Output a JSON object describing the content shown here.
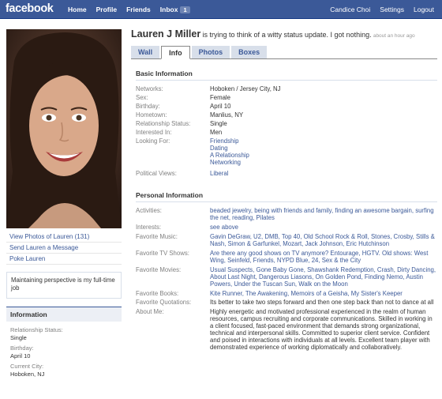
{
  "topbar": {
    "logo": "facebook",
    "nav": [
      "Home",
      "Profile",
      "Friends",
      "Inbox"
    ],
    "inbox_count": "1",
    "user": "Candice Choi",
    "settings": "Settings",
    "logout": "Logout",
    "color": "#3b5998"
  },
  "left": {
    "actions": [
      "View Photos of Lauren (131)",
      "Send Lauren a Message",
      "Poke Lauren"
    ],
    "status": "Maintaining perspective is my full-time job",
    "info_title": "Information",
    "info": [
      {
        "label": "Relationship Status:",
        "value": "Single"
      },
      {
        "label": "Birthday:",
        "value": "April 10"
      },
      {
        "label": "Current City:",
        "value": "Hoboken, NJ"
      }
    ]
  },
  "header": {
    "name": "Lauren J Miller",
    "status": "is trying to think of a witty status update. I got nothing.",
    "time": "about an hour ago"
  },
  "tabs": [
    "Wall",
    "Info",
    "Photos",
    "Boxes"
  ],
  "basic": {
    "title": "Basic Information",
    "rows": [
      {
        "label": "Networks:",
        "value": "Hoboken / Jersey City, NJ"
      },
      {
        "label": "Sex:",
        "value": "Female"
      },
      {
        "label": "Birthday:",
        "value": "April 10"
      },
      {
        "label": "Hometown:",
        "value": "Manlius, NY"
      },
      {
        "label": "Relationship Status:",
        "value": "Single"
      },
      {
        "label": "Interested In:",
        "value": "Men"
      }
    ],
    "looking_label": "Looking For:",
    "looking": [
      "Friendship",
      "Dating",
      "A Relationship",
      "Networking"
    ],
    "political_label": "Political Views:",
    "political": "Liberal"
  },
  "personal": {
    "title": "Personal Information",
    "activities_label": "Activities:",
    "activities": "beaded jewelry, being with friends and family, finding an awesome bargain, surfing the net, reading, Pilates",
    "interests_label": "Interests:",
    "interests": "see above",
    "music_label": "Favorite Music:",
    "music": "Gavin DeGraw, U2, DMB, Top 40, Old School Rock & Roll, Stones, Crosby, Stills & Nash, Simon & Garfunkel, Mozart, Jack Johnson, Eric Hutchinson",
    "tv_label": "Favorite TV Shows:",
    "tv": "Are there any good shows on TV anymore? Entourage, HGTV. Old shows: West Wing, Seinfeld, Friends, NYPD Blue, 24, Sex & the City",
    "movies_label": "Favorite Movies:",
    "movies": "Usual Suspects, Gone Baby Gone, Shawshank Redemption, Crash, Dirty Dancing, About Last Night, Dangerous Liasons, On Golden Pond, Finding Nemo, Austin Powers, Under the Tuscan Sun, Walk on the Moon",
    "books_label": "Favorite Books:",
    "books": "Kite Runner, The Awakening, Memoirs of a Geisha, My Sister's Keeper",
    "quotes_label": "Favorite Quotations:",
    "quotes": "Its better to take two steps forward and then one step back than not to dance at all",
    "about_label": "About Me:",
    "about": "Highly energetic and motivated professional experienced in the realm of human resources, campus recruiting and corporate communications. Skilled in working in a client focused, fast-paced environment that demands strong organizational, technical and interpersonal skills. Committed to superior client service. Confident and poised in interactions with individuals at all levels. Excellent team player with demonstrated experience of working diplomatically and collaboratively."
  }
}
